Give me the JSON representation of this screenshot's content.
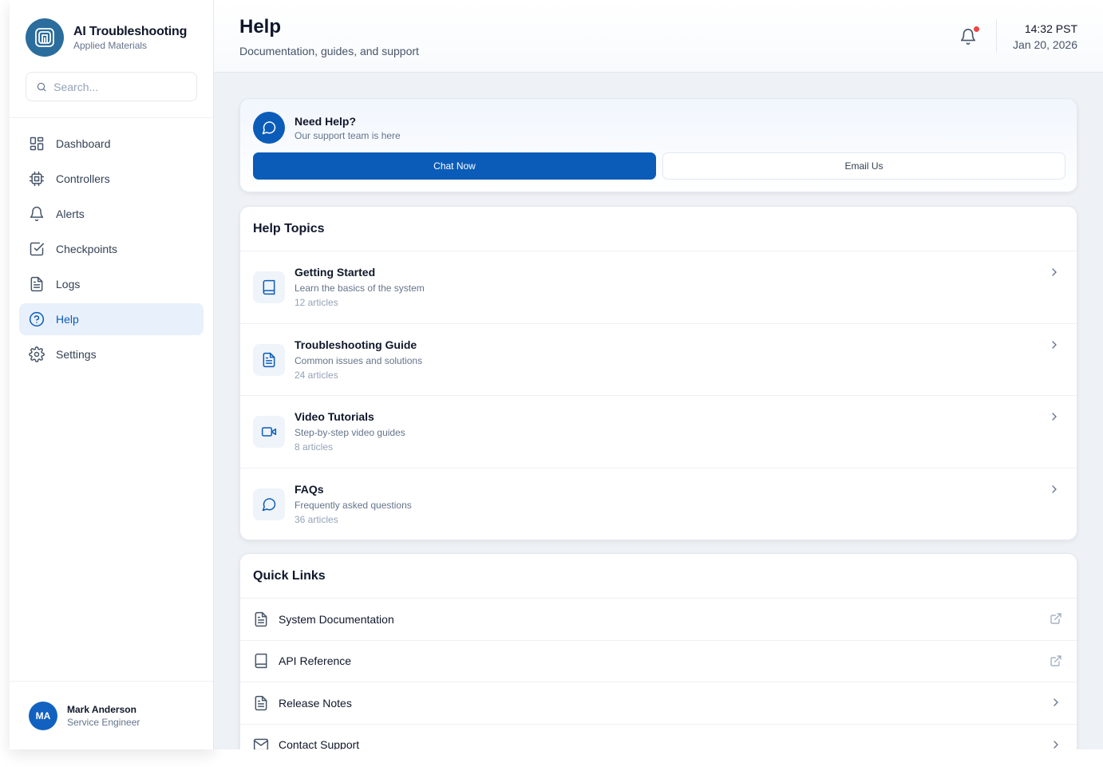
{
  "brand": {
    "title": "AI Troubleshooting",
    "subtitle": "Applied Materials"
  },
  "search": {
    "placeholder": "Search..."
  },
  "nav": [
    {
      "label": "Dashboard",
      "icon": "dashboard-icon"
    },
    {
      "label": "Controllers",
      "icon": "chip-icon"
    },
    {
      "label": "Alerts",
      "icon": "bell-icon"
    },
    {
      "label": "Checkpoints",
      "icon": "checkbox-icon"
    },
    {
      "label": "Logs",
      "icon": "document-icon"
    },
    {
      "label": "Help",
      "icon": "help-circle-icon",
      "active": true
    },
    {
      "label": "Settings",
      "icon": "gear-icon"
    }
  ],
  "user": {
    "initials": "MA",
    "name": "Mark Anderson",
    "role": "Service Engineer"
  },
  "header": {
    "title": "Help",
    "subtitle": "Documentation, guides, and support",
    "time": "14:32 PST",
    "date": "Jan 20, 2026"
  },
  "support": {
    "title": "Need Help?",
    "subtitle": "Our support team is here",
    "chat_label": "Chat Now",
    "email_label": "Email Us"
  },
  "topics": {
    "title": "Help Topics",
    "items": [
      {
        "title": "Getting Started",
        "desc": "Learn the basics of the system",
        "count": "12 articles",
        "icon": "book-icon"
      },
      {
        "title": "Troubleshooting Guide",
        "desc": "Common issues and solutions",
        "count": "24 articles",
        "icon": "document-icon"
      },
      {
        "title": "Video Tutorials",
        "desc": "Step-by-step video guides",
        "count": "8 articles",
        "icon": "video-icon"
      },
      {
        "title": "FAQs",
        "desc": "Frequently asked questions",
        "count": "36 articles",
        "icon": "chat-icon"
      }
    ]
  },
  "quick_links": {
    "title": "Quick Links",
    "items": [
      {
        "label": "System Documentation",
        "icon": "document-icon",
        "end": "external-link-icon"
      },
      {
        "label": "API Reference",
        "icon": "book-icon",
        "end": "external-link-icon"
      },
      {
        "label": "Release Notes",
        "icon": "document-icon",
        "end": "chevron-right-icon"
      },
      {
        "label": "Contact Support",
        "icon": "mail-icon",
        "end": "chevron-right-icon"
      }
    ]
  },
  "colors": {
    "primary": "#0b5cb8",
    "notification": "#ef4444",
    "brand_logo": "#2b6d9c"
  }
}
